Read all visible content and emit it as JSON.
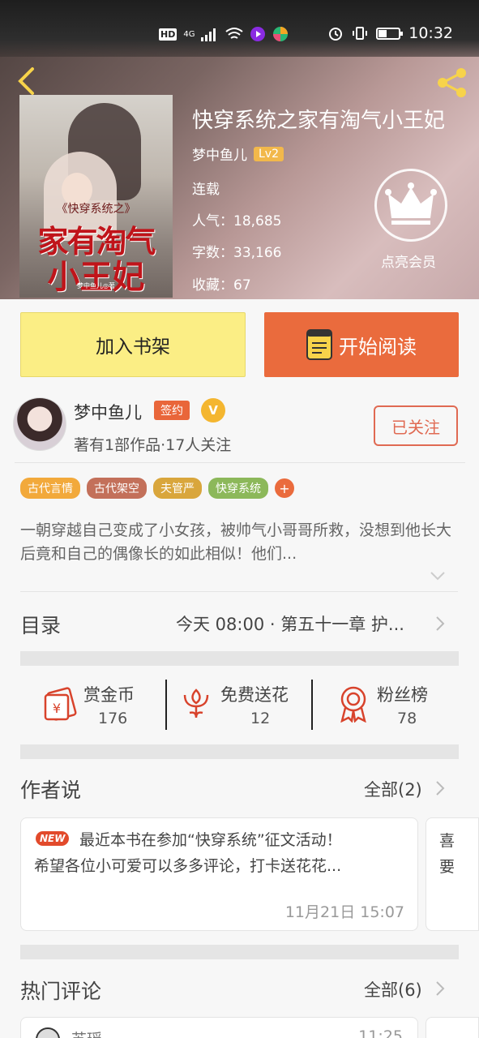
{
  "status_bar": {
    "network_labels": [
      "HD",
      "4G"
    ],
    "time": "10:32"
  },
  "book": {
    "title": "快穿系统之家有淘气小王妃",
    "author": "梦中鱼儿",
    "author_level": "Lv2",
    "status": "连载",
    "popularity_label": "人气：18,685",
    "word_count_label": "字数：33,166",
    "favorites_label": "收藏：67",
    "cover": {
      "subtitle": "《快穿系统之》",
      "title_line1": "家有淘气",
      "title_line2": "小王妃",
      "author_credit": "梦中鱼儿◎著"
    }
  },
  "vip": {
    "label": "点亮会员"
  },
  "actions": {
    "add_shelf": "加入书架",
    "start_reading": "开始阅读"
  },
  "author_card": {
    "name": "梦中鱼儿",
    "sign_badge": "签约",
    "v_badge": "V",
    "subtitle": "著有1部作品·17人关注",
    "follow_label": "已关注"
  },
  "tags": [
    {
      "label": "古代言情",
      "color": "#f2a93b"
    },
    {
      "label": "古代架空",
      "color": "#c3705a"
    },
    {
      "label": "夫管严",
      "color": "#d9a63c"
    },
    {
      "label": "快穿系统",
      "color": "#8cb85a"
    }
  ],
  "tags_more": "+",
  "intro": "一朝穿越自己变成了小女孩，被帅气小哥哥所救，没想到他长大后竟和自己的偶像长的如此相似！他们...",
  "toc": {
    "title": "目录",
    "latest": "今天 08:00 · 第五十一章 护..."
  },
  "stats": [
    {
      "label": "赏金币",
      "value": "176",
      "icon": "red-envelope-icon"
    },
    {
      "label": "免费送花",
      "value": "12",
      "icon": "flower-icon"
    },
    {
      "label": "粉丝榜",
      "value": "78",
      "icon": "medal-icon"
    }
  ],
  "author_says": {
    "title": "作者说",
    "all_link": "全部(2)",
    "post": {
      "badge": "NEW",
      "line1": "最近本书在参加“快穿系统”征文活动！",
      "line2": "希望各位小可爱可以多多评论，打卡送花花...",
      "time": "11月21日  15:07"
    },
    "post2_text": "喜\n要"
  },
  "hot_comments": {
    "title": "热门评论",
    "all_link": "全部(6)",
    "first": {
      "name": "苏瑶",
      "time": "11:25"
    }
  },
  "colors": {
    "accent_orange": "#ea6b3d",
    "shelf_yellow": "#fbee85",
    "follow_red": "#e06a53",
    "vip_gold": "#f2b84b"
  }
}
